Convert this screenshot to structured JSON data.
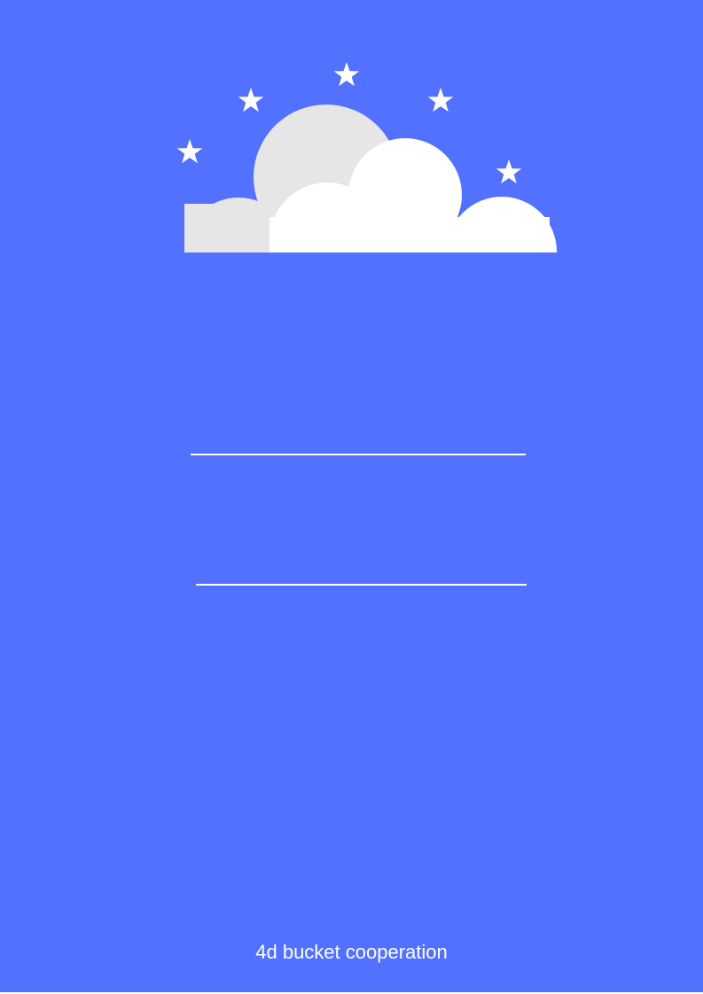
{
  "cover": {
    "background_color": "#5271ff",
    "illustration": {
      "icon": "cloud-with-stars",
      "cloud_back_color": "#e6e6e6",
      "cloud_front_color": "#ffffff",
      "star_color": "#ffffff"
    },
    "footer_text": "4d bucket cooperation"
  }
}
